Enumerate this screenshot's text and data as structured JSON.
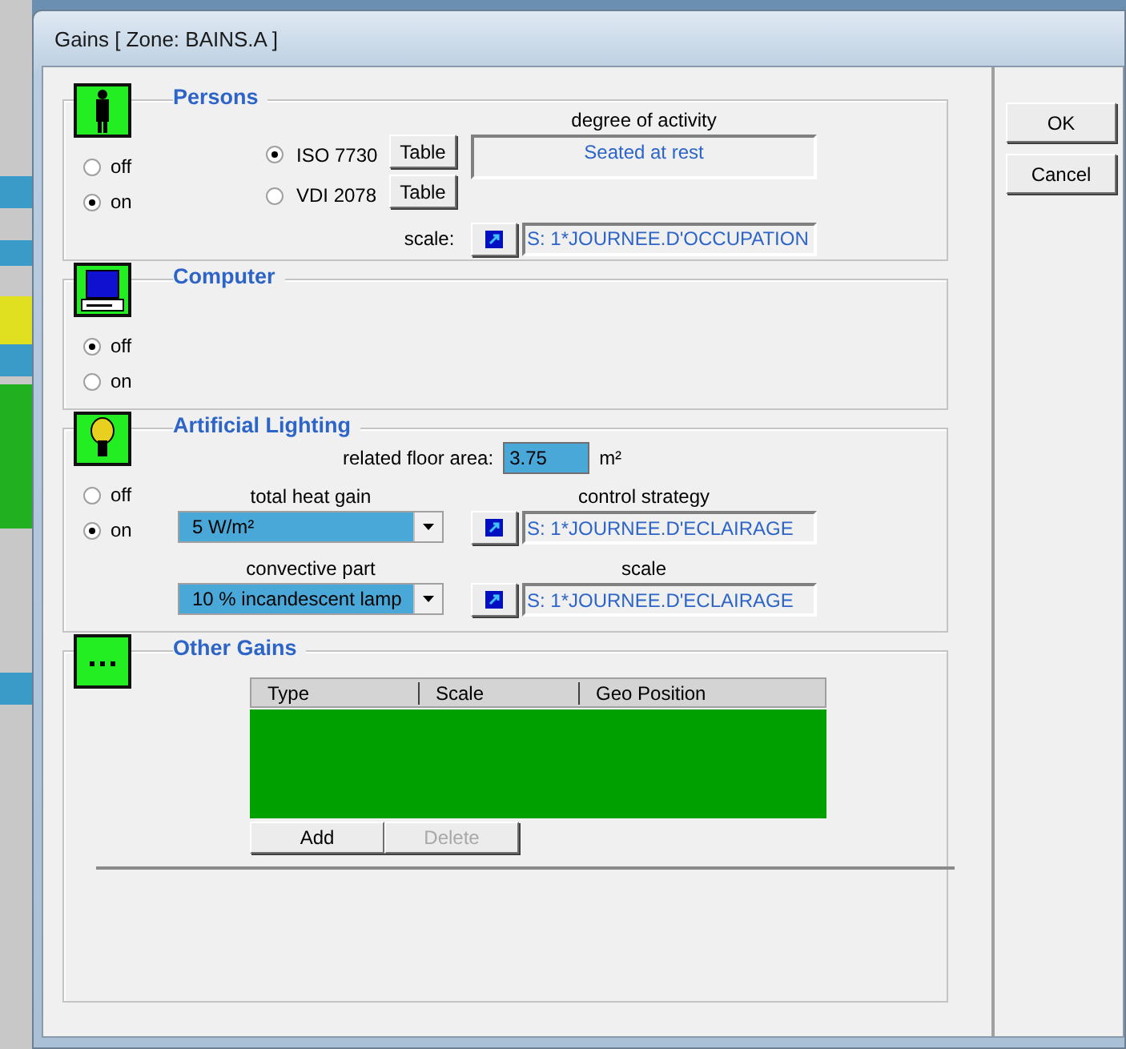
{
  "window": {
    "title": "Gains [ Zone: BAINS.A ]"
  },
  "sections": [
    {
      "kind": "persons",
      "title": "Persons",
      "modes": [
        {
          "label": "off",
          "selected": false
        },
        {
          "label": "on",
          "selected": true
        }
      ],
      "standards": [
        {
          "label": "ISO 7730",
          "selected": true,
          "button": "Table"
        },
        {
          "label": "VDI 2078",
          "selected": false,
          "button": "Table"
        }
      ],
      "activity": {
        "label": "degree of activity",
        "value": "Seated at rest"
      },
      "scale": {
        "label": "scale:",
        "value": "S: 1*JOURNEE.D'OCCUPATION"
      }
    },
    {
      "kind": "computer",
      "title": "Computer",
      "modes": [
        {
          "label": "off",
          "selected": true
        },
        {
          "label": "on",
          "selected": false
        }
      ]
    },
    {
      "kind": "lighting",
      "title": "Artificial Lighting",
      "modes": [
        {
          "label": "off",
          "selected": false
        },
        {
          "label": "on",
          "selected": true
        }
      ],
      "floor_area": {
        "label": "related floor area:",
        "value": "3.75",
        "unit": "m²"
      },
      "heat_gain": {
        "label": "total heat gain",
        "value": "5  W/m²"
      },
      "control_strategy": {
        "label": "control strategy",
        "value": "S: 1*JOURNEE.D'ECLAIRAGE"
      },
      "convective_part": {
        "label": "convective part",
        "value": "10  % incandescent lamp"
      },
      "scale": {
        "label": "scale",
        "value": "S: 1*JOURNEE.D'ECLAIRAGE"
      }
    },
    {
      "kind": "other",
      "title": "Other Gains",
      "table": {
        "columns": [
          "Type",
          "Scale",
          "Geo Position"
        ]
      },
      "buttons": [
        {
          "label": "Add",
          "disabled": false
        },
        {
          "label": "Delete",
          "disabled": true
        }
      ]
    }
  ],
  "buttons": [
    {
      "label": "OK"
    },
    {
      "label": "Cancel"
    }
  ]
}
